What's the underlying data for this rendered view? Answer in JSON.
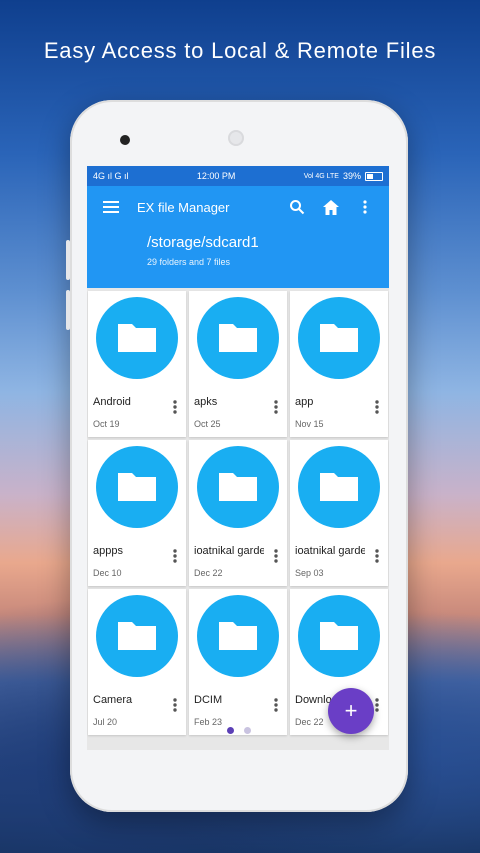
{
  "headline": "Easy Access to Local & Remote Files",
  "status": {
    "left": "4G ıl  G ıl",
    "time": "12:00 PM",
    "network": "Vol 4G LTE",
    "battery": "39%"
  },
  "appbar": {
    "title": "EX file Manager",
    "icons": [
      "menu-icon",
      "search-icon",
      "home-icon",
      "more-vert-icon"
    ]
  },
  "path": {
    "current": "/storage/sdcard1",
    "summary": "29 folders and 7 files"
  },
  "folders": [
    {
      "name": "Android",
      "date": "Oct 19"
    },
    {
      "name": "apks",
      "date": "Oct 25"
    },
    {
      "name": "app",
      "date": "Nov 15"
    },
    {
      "name": "appps",
      "date": "Dec 10"
    },
    {
      "name": "ioatnikal garde",
      "date": "Dec 22"
    },
    {
      "name": "ioatnikal garde",
      "date": "Sep 03"
    },
    {
      "name": "Camera",
      "date": "Jul 20"
    },
    {
      "name": "DCIM",
      "date": "Feb 23"
    },
    {
      "name": "Downlo",
      "date": "Dec 22"
    }
  ],
  "fab": {
    "label": "+"
  },
  "page_indicator": {
    "active": 0,
    "total": 2
  },
  "colors": {
    "appbar": "#2196f3",
    "statusbar": "#1d6fd2",
    "folder": "#19aef2",
    "fab": "#6a3ec6"
  }
}
